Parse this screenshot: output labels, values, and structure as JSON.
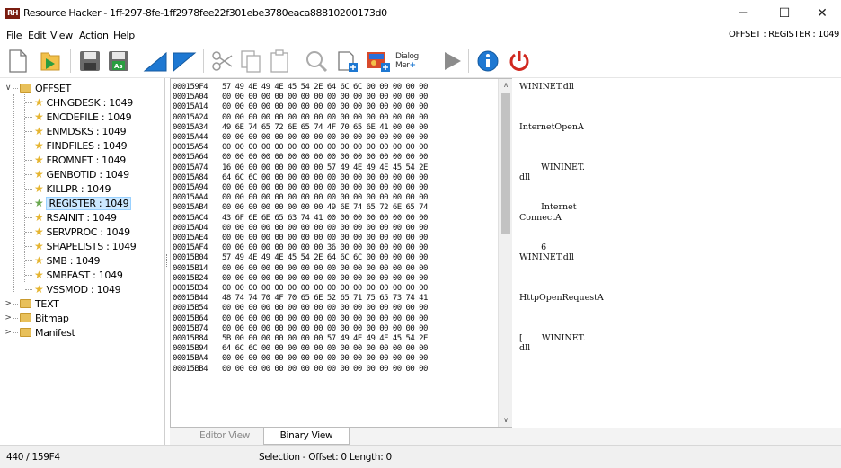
{
  "window": {
    "app_icon_text": "RH",
    "title": "Resource Hacker - 1ff-297-8fe-1ff2978fee22f301ebe3780eaca88810200173d0",
    "minimize_glyph": "─",
    "maximize_glyph": "☐",
    "close_glyph": "✕"
  },
  "menubar": {
    "items": [
      "File",
      "Edit",
      "View",
      "Action",
      "Help"
    ],
    "offset_label": "OFFSET : REGISTER : 1049"
  },
  "toolbar": {
    "icons": [
      "new-file-icon",
      "open-folder-icon",
      "save-icon",
      "save-as-icon",
      "back-arrow-icon",
      "forward-arrow-icon",
      "cut-icon",
      "copy-icon",
      "paste-icon",
      "search-icon",
      "add-resource-icon",
      "dialog-image-icon",
      "dialog-merge-icon",
      "play-icon",
      "info-icon",
      "power-icon"
    ],
    "dialog_merge_label": [
      "Dialog",
      "Mer"
    ],
    "colors": {
      "green": "#2a9d40",
      "blue": "#1e78d2",
      "red": "#d0281f",
      "gray": "#6b6b6b"
    }
  },
  "tree": {
    "root": {
      "label": "OFFSET",
      "expander": "∨"
    },
    "children": [
      {
        "label": "CHNGDESK : 1049"
      },
      {
        "label": "ENCDEFILE : 1049"
      },
      {
        "label": "ENMDSKS : 1049"
      },
      {
        "label": "FINDFILES : 1049"
      },
      {
        "label": "FROMNET : 1049"
      },
      {
        "label": "GENBOTID : 1049"
      },
      {
        "label": "KILLPR : 1049"
      },
      {
        "label": "REGISTER : 1049",
        "selected": true
      },
      {
        "label": "RSAINIT : 1049"
      },
      {
        "label": "SERVPROC : 1049"
      },
      {
        "label": "SHAPELISTS : 1049"
      },
      {
        "label": "SMB : 1049"
      },
      {
        "label": "SMBFAST : 1049"
      },
      {
        "label": "VSSMOD : 1049"
      }
    ],
    "siblings": [
      {
        "label": "TEXT",
        "expander": ">"
      },
      {
        "label": "Bitmap",
        "expander": ">"
      },
      {
        "label": "Manifest",
        "expander": ">"
      }
    ]
  },
  "hex": {
    "rows": [
      {
        "addr": "000159F4",
        "bytes": "57 49 4E 49 4E 45 54 2E 64 6C 6C 00 00 00 00 00"
      },
      {
        "addr": "00015A04",
        "bytes": "00 00 00 00 00 00 00 00 00 00 00 00 00 00 00 00"
      },
      {
        "addr": "00015A14",
        "bytes": "00 00 00 00 00 00 00 00 00 00 00 00 00 00 00 00"
      },
      {
        "addr": "00015A24",
        "bytes": "00 00 00 00 00 00 00 00 00 00 00 00 00 00 00 00"
      },
      {
        "addr": "00015A34",
        "bytes": "49 6E 74 65 72 6E 65 74 4F 70 65 6E 41 00 00 00"
      },
      {
        "addr": "00015A44",
        "bytes": "00 00 00 00 00 00 00 00 00 00 00 00 00 00 00 00"
      },
      {
        "addr": "00015A54",
        "bytes": "00 00 00 00 00 00 00 00 00 00 00 00 00 00 00 00"
      },
      {
        "addr": "00015A64",
        "bytes": "00 00 00 00 00 00 00 00 00 00 00 00 00 00 00 00"
      },
      {
        "addr": "00015A74",
        "bytes": "16 00 00 00 00 00 00 00 57 49 4E 49 4E 45 54 2E"
      },
      {
        "addr": "00015A84",
        "bytes": "64 6C 6C 00 00 00 00 00 00 00 00 00 00 00 00 00"
      },
      {
        "addr": "00015A94",
        "bytes": "00 00 00 00 00 00 00 00 00 00 00 00 00 00 00 00"
      },
      {
        "addr": "00015AA4",
        "bytes": "00 00 00 00 00 00 00 00 00 00 00 00 00 00 00 00"
      },
      {
        "addr": "00015AB4",
        "bytes": "00 00 00 00 00 00 00 00 49 6E 74 65 72 6E 65 74"
      },
      {
        "addr": "00015AC4",
        "bytes": "43 6F 6E 6E 65 63 74 41 00 00 00 00 00 00 00 00"
      },
      {
        "addr": "00015AD4",
        "bytes": "00 00 00 00 00 00 00 00 00 00 00 00 00 00 00 00"
      },
      {
        "addr": "00015AE4",
        "bytes": "00 00 00 00 00 00 00 00 00 00 00 00 00 00 00 00"
      },
      {
        "addr": "00015AF4",
        "bytes": "00 00 00 00 00 00 00 00 36 00 00 00 00 00 00 00"
      },
      {
        "addr": "00015B04",
        "bytes": "57 49 4E 49 4E 45 54 2E 64 6C 6C 00 00 00 00 00"
      },
      {
        "addr": "00015B14",
        "bytes": "00 00 00 00 00 00 00 00 00 00 00 00 00 00 00 00"
      },
      {
        "addr": "00015B24",
        "bytes": "00 00 00 00 00 00 00 00 00 00 00 00 00 00 00 00"
      },
      {
        "addr": "00015B34",
        "bytes": "00 00 00 00 00 00 00 00 00 00 00 00 00 00 00 00"
      },
      {
        "addr": "00015B44",
        "bytes": "48 74 74 70 4F 70 65 6E 52 65 71 75 65 73 74 41"
      },
      {
        "addr": "00015B54",
        "bytes": "00 00 00 00 00 00 00 00 00 00 00 00 00 00 00 00"
      },
      {
        "addr": "00015B64",
        "bytes": "00 00 00 00 00 00 00 00 00 00 00 00 00 00 00 00"
      },
      {
        "addr": "00015B74",
        "bytes": "00 00 00 00 00 00 00 00 00 00 00 00 00 00 00 00"
      },
      {
        "addr": "00015B84",
        "bytes": "5B 00 00 00 00 00 00 00 57 49 4E 49 4E 45 54 2E"
      },
      {
        "addr": "00015B94",
        "bytes": "64 6C 6C 00 00 00 00 00 00 00 00 00 00 00 00 00"
      },
      {
        "addr": "00015BA4",
        "bytes": "00 00 00 00 00 00 00 00 00 00 00 00 00 00 00 00"
      },
      {
        "addr": "00015BB4",
        "bytes": "00 00 00 00 00 00 00 00 00 00 00 00 00 00 00 00"
      }
    ],
    "scroll_up": "∧",
    "scroll_down": "∨"
  },
  "ascii": {
    "rows": [
      "WININET.dll",
      "",
      "",
      "",
      "InternetOpenA",
      "",
      "",
      "",
      "        WININET.",
      "dll",
      "",
      "",
      "        Internet",
      "ConnectA",
      "",
      "",
      "        6",
      "WININET.dll",
      "",
      "",
      "",
      "HttpOpenRequestA",
      "",
      "",
      "",
      "[       WININET.",
      "dll",
      "",
      ""
    ]
  },
  "tabs": {
    "editor": "Editor View",
    "binary": "Binary View"
  },
  "status": {
    "position": "440 / 159F4",
    "selection": "Selection - Offset: 0  Length: 0"
  }
}
